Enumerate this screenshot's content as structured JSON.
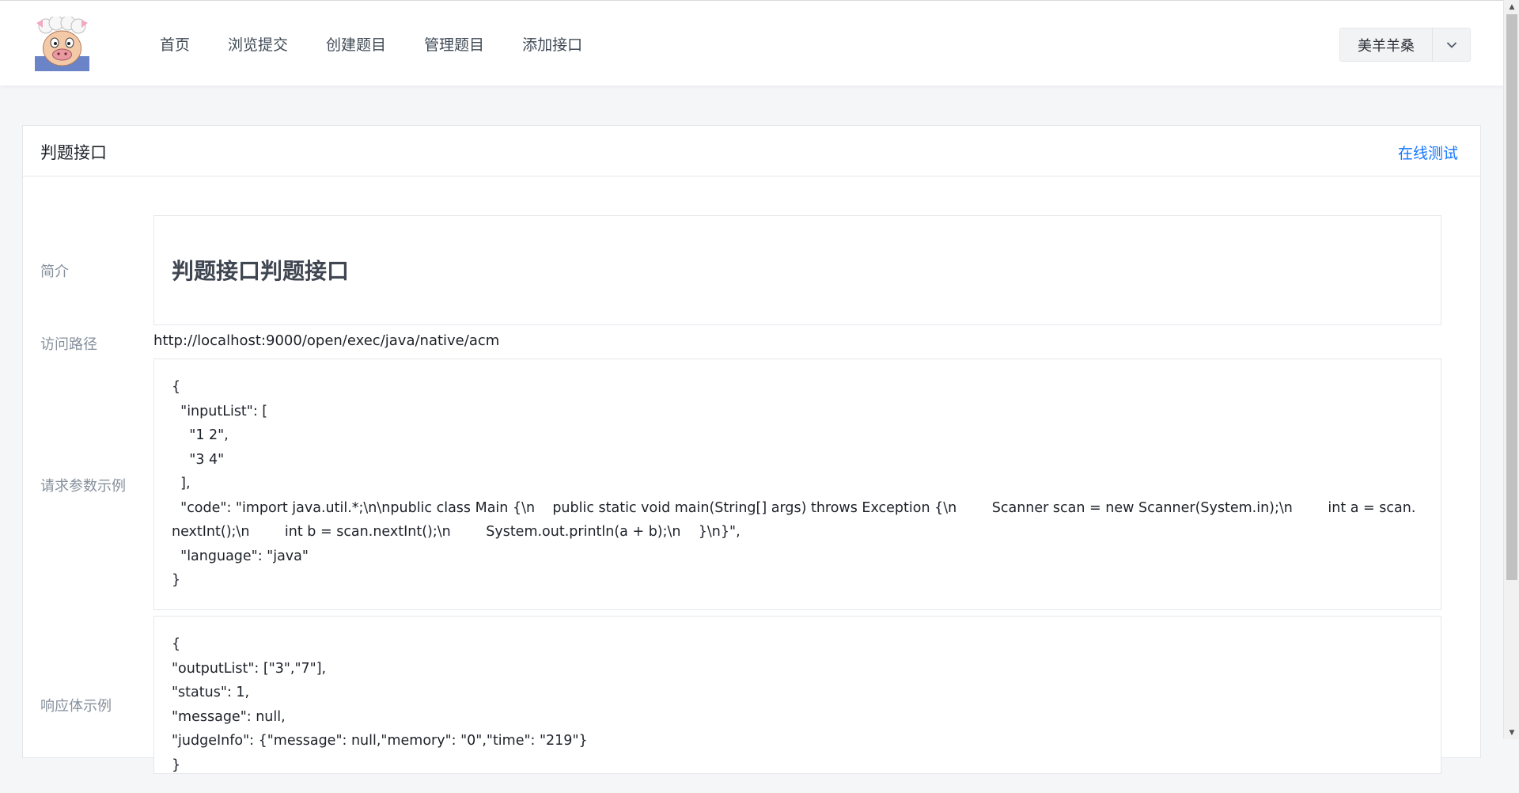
{
  "header": {
    "logo": "sheep-avatar-logo",
    "nav": [
      {
        "label": "首页"
      },
      {
        "label": "浏览提交"
      },
      {
        "label": "创建题目"
      },
      {
        "label": "管理题目"
      },
      {
        "label": "添加接口"
      }
    ],
    "user": {
      "name": "美羊羊桑",
      "caret_icon": "chevron-down-icon"
    }
  },
  "card": {
    "title": "判题接口",
    "action_link": "在线测试",
    "fields": {
      "intro": {
        "label": "简介",
        "value": "判题接口判题接口"
      },
      "path": {
        "label": "访问路径",
        "value": "http://localhost:9000/open/exec/java/native/acm"
      },
      "request": {
        "label": "请求参数示例",
        "value": "{\n  \"inputList\": [\n    \"1 2\",\n    \"3 4\"\n  ],\n  \"code\": \"import java.util.*;\\n\\npublic class Main {\\n    public static void main(String[] args) throws Exception {\\n        Scanner scan = new Scanner(System.in);\\n        int a = scan.nextInt();\\n        int b = scan.nextInt();\\n        System.out.println(a + b);\\n    }\\n}\",\n  \"language\": \"java\"\n}"
      },
      "response": {
        "label": "响应体示例",
        "value": "{\n\"outputList\": [\"3\",\"7\"],\n\"status\": 1,\n\"message\": null,\n\"judgeInfo\": {\"message\": null,\"memory\": \"0\",\"time\": \"219\"}\n}"
      }
    }
  },
  "colors": {
    "link": "#1677ff",
    "label": "#86909c",
    "border": "#e5e6eb"
  }
}
